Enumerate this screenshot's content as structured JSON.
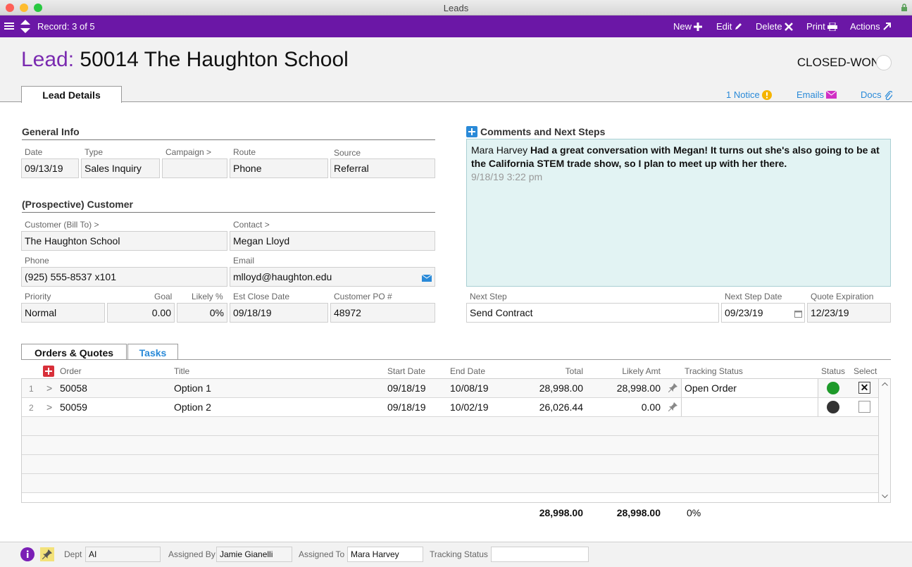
{
  "window": {
    "title": "Leads"
  },
  "toolbar": {
    "record": "Record: 3 of 5",
    "new": "New",
    "edit": "Edit",
    "delete": "Delete",
    "print": "Print",
    "actions": "Actions"
  },
  "header": {
    "prefix": "Lead:",
    "title": "50014 The Haughton School",
    "stage": "CLOSED-WON",
    "tab": "Lead Details",
    "notice": "1 Notice",
    "emails": "Emails",
    "docs": "Docs"
  },
  "general": {
    "heading": "General Info",
    "date_label": "Date",
    "date": "09/13/19",
    "type_label": "Type",
    "type": "Sales Inquiry",
    "campaign_label": "Campaign >",
    "campaign": "",
    "route_label": "Route",
    "route": "Phone",
    "source_label": "Source",
    "source": "Referral"
  },
  "customer": {
    "heading": "(Prospective) Customer",
    "bill_to_label": "Customer (Bill To) >",
    "bill_to": "The Haughton School",
    "contact_label": "Contact >",
    "contact": "Megan Lloyd",
    "phone_label": "Phone",
    "phone": "(925) 555-8537 x101",
    "email_label": "Email",
    "email": "mlloyd@haughton.edu",
    "priority_label": "Priority",
    "priority": "Normal",
    "goal_label": "Goal",
    "goal": "0.00",
    "likely_label": "Likely %",
    "likely": "0%",
    "close_label": "Est Close Date",
    "close": "09/18/19",
    "po_label": "Customer PO #",
    "po": "48972"
  },
  "comments": {
    "heading": "Comments and Next Steps",
    "author": "Mara Harvey",
    "text": "Had a great conversation with Megan! It turns out she's also going to be at the California STEM trade show, so I plan to meet up with her there.",
    "time": "9/18/19  3:22 pm"
  },
  "next": {
    "step_label": "Next Step",
    "step": "Send Contract",
    "date_label": "Next Step Date",
    "date": "09/23/19",
    "quote_label": "Quote Expiration",
    "quote": "12/23/19"
  },
  "orders": {
    "tab_orders": "Orders & Quotes",
    "tab_tasks": "Tasks",
    "columns": {
      "order": "Order",
      "title": "Title",
      "start": "Start Date",
      "end": "End Date",
      "total": "Total",
      "likely": "Likely Amt",
      "tracking": "Tracking Status",
      "status": "Status",
      "select": "Select"
    },
    "rows": [
      {
        "num": "1",
        "arrow": ">",
        "order": "50058",
        "title": "Option 1",
        "start": "09/18/19",
        "end": "10/08/19",
        "total": "28,998.00",
        "likely": "28,998.00",
        "tracking": "Open Order",
        "status_color": "#1e9a2a",
        "selected": "✕"
      },
      {
        "num": "2",
        "arrow": ">",
        "order": "50059",
        "title": "Option 2",
        "start": "09/18/19",
        "end": "10/02/19",
        "total": "26,026.44",
        "likely": "0.00",
        "tracking": "",
        "status_color": "#333333",
        "selected": ""
      }
    ],
    "sum_total": "28,998.00",
    "sum_likely": "28,998.00",
    "sum_pct": "0%"
  },
  "footer": {
    "dept_label": "Dept",
    "dept": "AI",
    "assigned_by_label": "Assigned By",
    "assigned_by": "Jamie Gianelli",
    "assigned_to_label": "Assigned To",
    "assigned_to": "Mara Harvey",
    "tracking_label": "Tracking Status",
    "tracking": ""
  },
  "colors": {
    "accent": "#6b17a6",
    "link": "#2a8ad8",
    "comment_bg": "#e2f3f3"
  }
}
